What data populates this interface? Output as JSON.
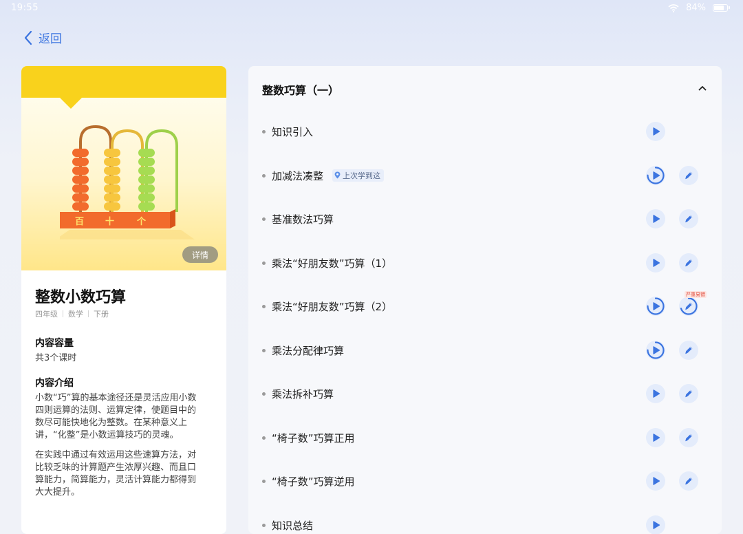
{
  "status_bar": {
    "time": "19:55",
    "battery": "84%"
  },
  "nav": {
    "back_label": "返回"
  },
  "course": {
    "title": "整数小数巧算",
    "tags": [
      "四年级",
      "数学",
      "下册"
    ],
    "detail_button": "详情",
    "abacus_labels": [
      "百",
      "十",
      "个"
    ],
    "capacity_heading": "内容容量",
    "capacity_text": "共3个课时",
    "intro_heading": "内容介绍",
    "intro_lines_1": [
      "小数“巧”算的基本途径还是灵活应用小数",
      "四则运算的法则、运算定律，使题目中的",
      "数尽可能快地化为整数。在某种意义上",
      "讲，“化整”是小数运算技巧的灵魂。"
    ],
    "intro_lines_2": [
      "在实践中通过有效运用这些速算方法，对",
      "比较乏味的计算题产生浓厚兴趣、而且口",
      "算能力，简算能力，灵活计算能力都得到",
      "大大提升。"
    ]
  },
  "unit": {
    "title": "整数巧算（一）",
    "last_learned_badge": "上次学到这",
    "hot_tag": "严重易错",
    "lessons": [
      {
        "name": "知识引入",
        "has_exercise": false,
        "play_progress": 0
      },
      {
        "name": "加减法凑整",
        "has_exercise": true,
        "play_progress": 0.75
      },
      {
        "name": "基准数法巧算",
        "has_exercise": true,
        "play_progress": 0
      },
      {
        "name": "乘法“好朋友数”巧算（1）",
        "has_exercise": true,
        "play_progress": 0
      },
      {
        "name": "乘法“好朋友数”巧算（2）",
        "has_exercise": true,
        "play_progress": 0.75
      },
      {
        "name": "乘法分配律巧算",
        "has_exercise": true,
        "play_progress": 0.75
      },
      {
        "name": "乘法拆补巧算",
        "has_exercise": true,
        "play_progress": 0
      },
      {
        "name": "“椅子数”巧算正用",
        "has_exercise": true,
        "play_progress": 0
      },
      {
        "name": "“椅子数”巧算逆用",
        "has_exercise": true,
        "play_progress": 0
      },
      {
        "name": "知识总结",
        "has_exercise": false,
        "play_progress": 0
      }
    ]
  },
  "colors": {
    "accent": "#3b74e0",
    "cover_yellow": "#f9d21c",
    "hot": "#e04a3a"
  }
}
